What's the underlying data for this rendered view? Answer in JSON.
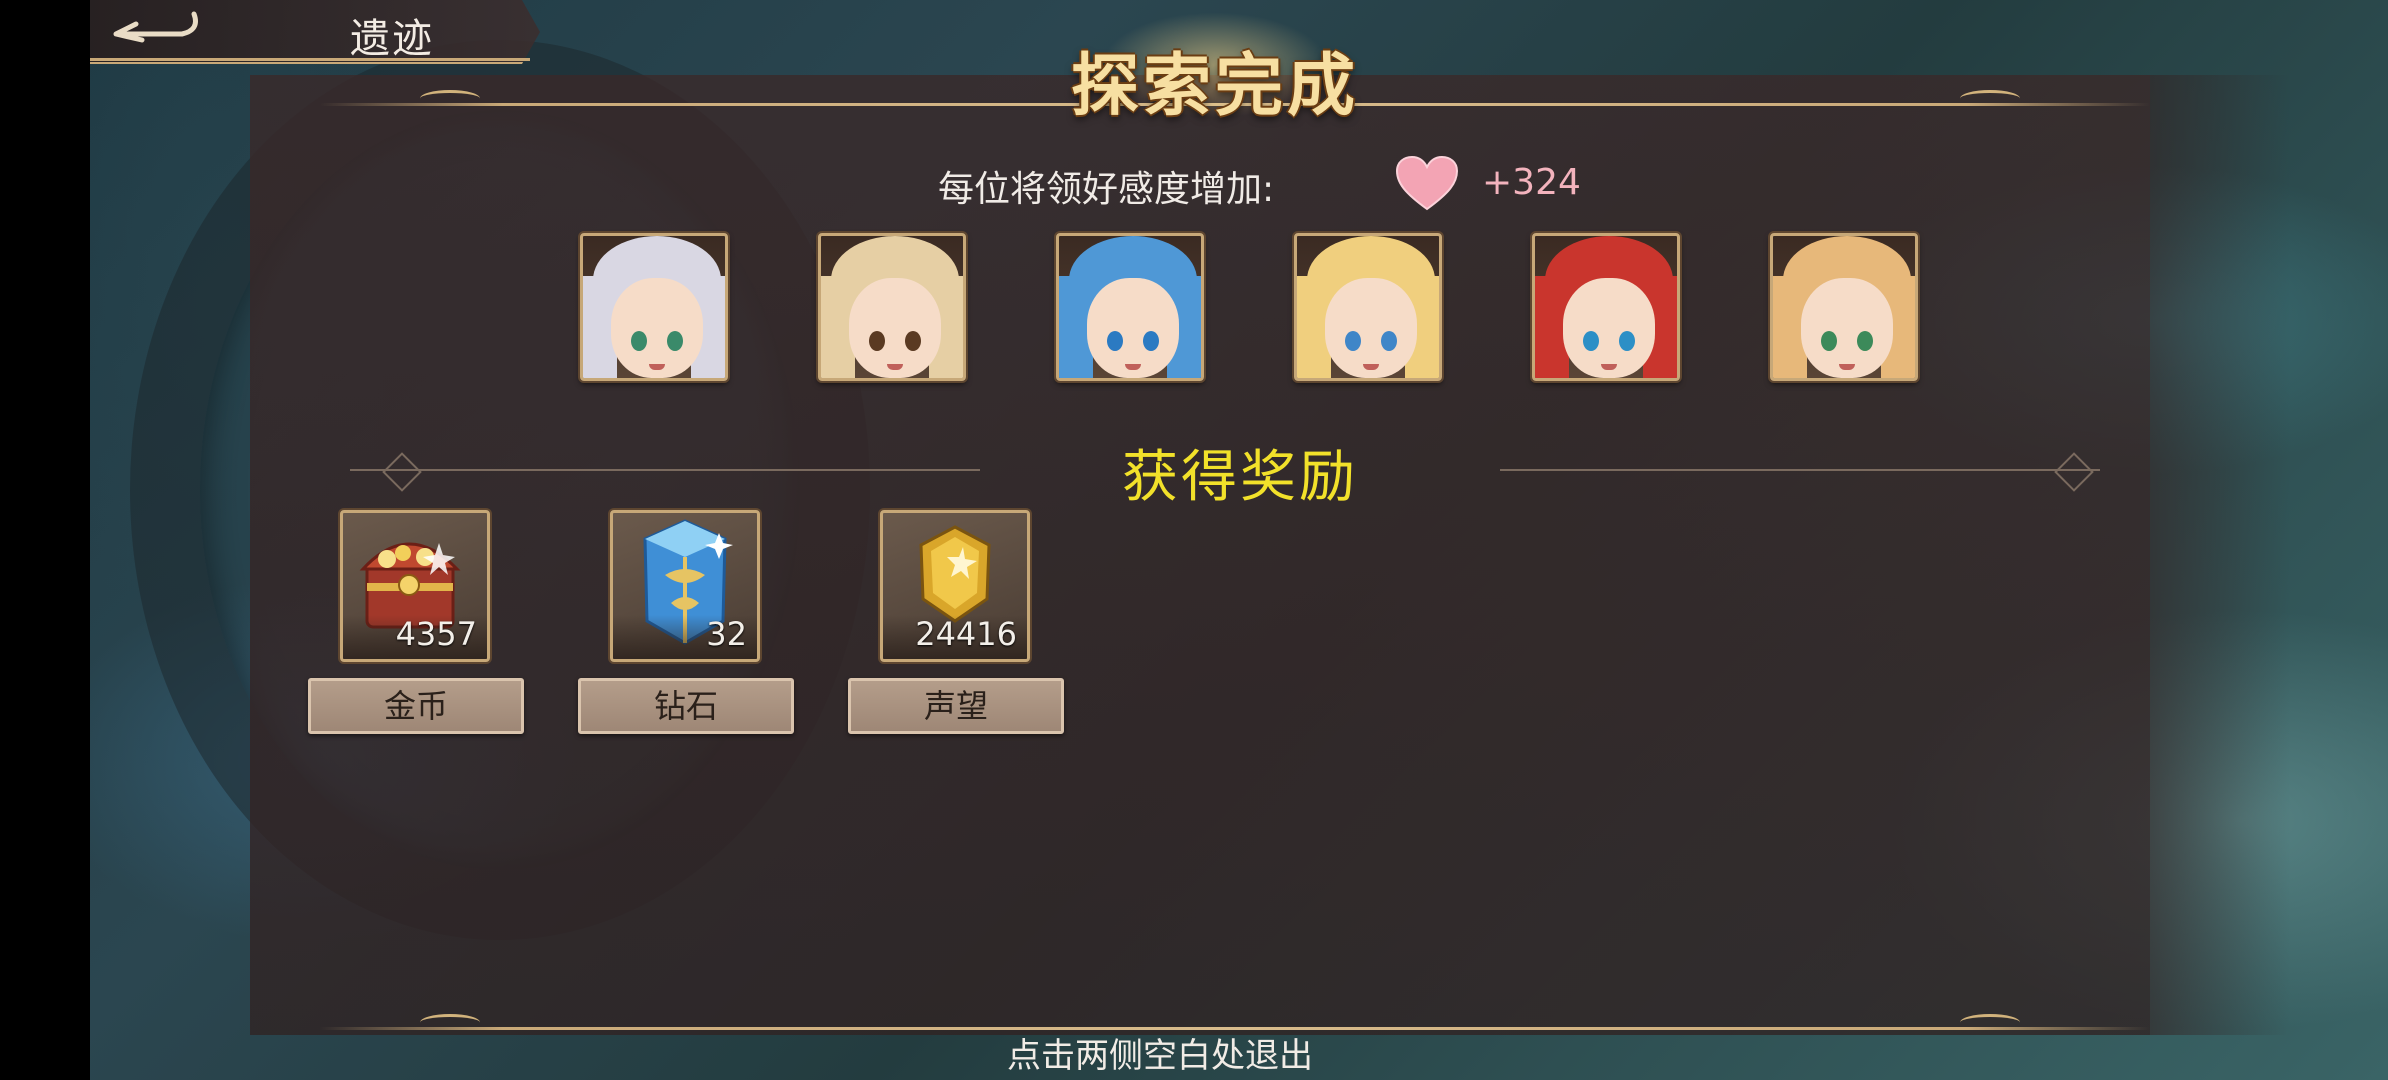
{
  "header": {
    "title": "遗迹"
  },
  "banner": {
    "title": "探索完成"
  },
  "affection": {
    "label": "每位将领好感度增加:",
    "value": "+324",
    "icon": "heart-icon",
    "heart_color": "#f3a4b4"
  },
  "portraits": [
    {
      "name": "hero-1",
      "hair": "#d9d7e3",
      "eyes": "#3a8a6a"
    },
    {
      "name": "hero-2",
      "hair": "#e6cfa4",
      "eyes": "#5a3a22"
    },
    {
      "name": "hero-3",
      "hair": "#4f98d6",
      "eyes": "#2b7ac2"
    },
    {
      "name": "hero-4",
      "hair": "#f0cf7e",
      "eyes": "#3f86c8"
    },
    {
      "name": "hero-5",
      "hair": "#c9352d",
      "eyes": "#2c8fc6"
    },
    {
      "name": "hero-6",
      "hair": "#e7b87a",
      "eyes": "#3c8a5a"
    }
  ],
  "rewards": {
    "title": "获得奖励",
    "title_color": "#f2e12a",
    "items": [
      {
        "label": "金币",
        "count": "4357",
        "icon": "treasure-chest-icon"
      },
      {
        "label": "钻石",
        "count": "32",
        "icon": "diamond-crystal-icon"
      },
      {
        "label": "声望",
        "count": "24416",
        "icon": "reputation-badge-icon"
      }
    ]
  },
  "footer": {
    "hint": "点击两侧空白处退出"
  }
}
